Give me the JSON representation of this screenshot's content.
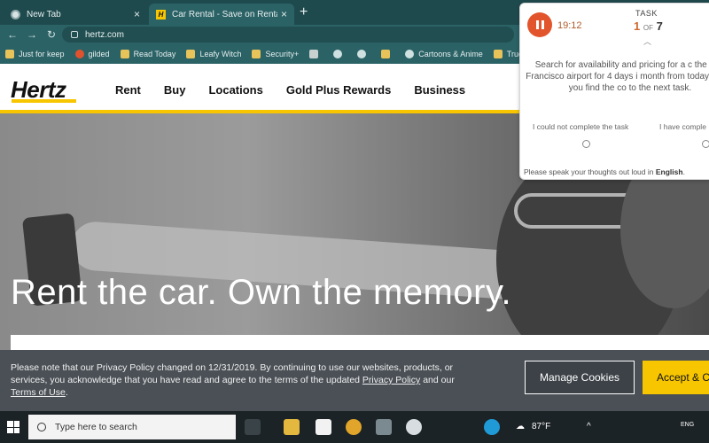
{
  "browser": {
    "tabs": [
      {
        "title": "New Tab",
        "icon": "chrome-icon"
      },
      {
        "title": "Car Rental - Save on Rental Cars",
        "icon": "hertz-favicon"
      }
    ],
    "new_tab_symbol": "+",
    "url": "hertz.com",
    "bookmarks": [
      {
        "label": "Just for keep",
        "icon": "folder-icon"
      },
      {
        "label": "gilded",
        "icon": "reddit-icon"
      },
      {
        "label": "Read Today",
        "icon": "folder-icon"
      },
      {
        "label": "Leafy Witch",
        "icon": "folder-icon"
      },
      {
        "label": "Security+",
        "icon": "folder-icon"
      },
      {
        "label": "",
        "icon": "calendar-icon"
      },
      {
        "label": "",
        "icon": "globe-icon"
      },
      {
        "label": "",
        "icon": "apple-icon"
      },
      {
        "label": "",
        "icon": "folder-icon"
      },
      {
        "label": "Cartoons & Anime",
        "icon": "globe-icon"
      },
      {
        "label": "True iService",
        "icon": "folder-icon"
      }
    ]
  },
  "site": {
    "logo": "Hertz",
    "nav": [
      "Rent",
      "Buy",
      "Locations",
      "Gold Plus Rewards",
      "Business"
    ],
    "hero_title": "Rent the car. Own the memory."
  },
  "cookie_banner": {
    "text_prefix": "Please note that our Privacy Policy changed on 12/31/2019. By continuing to use our websites, products, or services, you acknowledge that you have read and agree to the terms of the updated ",
    "privacy_link": "Privacy Policy",
    "and": " and our ",
    "terms_link": "Terms of Use",
    "end": ".",
    "manage_label": "Manage Cookies",
    "accept_label": "Accept & C"
  },
  "task_panel": {
    "timer": "19:12",
    "label": "TASK",
    "current": "1",
    "of": "OF",
    "total": "7",
    "instruction": "Search for availability and pricing for a c the San Francisco airport for 4 days i month from today. Once you find the co to the next task.",
    "option_fail": "I could not complete the task",
    "option_done": "I have comple",
    "speak_prefix": "Please speak your thoughts out loud in ",
    "speak_lang": "English",
    "speak_end": "."
  },
  "taskbar": {
    "search_placeholder": "Type here to search",
    "weather": "87°F",
    "lang": "ENG"
  },
  "colors": {
    "hertz_yellow": "#f7c600",
    "chrome_dark": "#1f4a4d",
    "chrome_light": "#2b6266",
    "record_orange": "#e2542c",
    "banner_gray": "#4a5056"
  }
}
